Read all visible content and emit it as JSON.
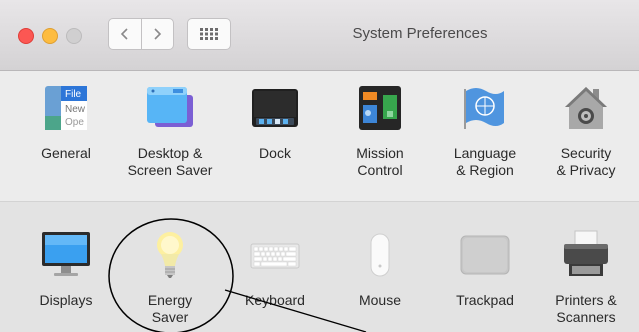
{
  "window": {
    "title": "System Preferences",
    "back_icon": "chevron-left-icon",
    "forward_icon": "chevron-right-icon",
    "grid_icon": "show-all-grid-icon"
  },
  "row1": [
    {
      "id": "general",
      "line1": "General",
      "line2": "",
      "icon": "general-icon"
    },
    {
      "id": "desktop",
      "line1": "Desktop &",
      "line2": "Screen Saver",
      "icon": "desktop-screensaver-icon"
    },
    {
      "id": "dock",
      "line1": "Dock",
      "line2": "",
      "icon": "dock-icon"
    },
    {
      "id": "mission",
      "line1": "Mission",
      "line2": "Control",
      "icon": "mission-control-icon"
    },
    {
      "id": "language",
      "line1": "Language",
      "line2": "& Region",
      "icon": "language-region-icon"
    },
    {
      "id": "security",
      "line1": "Security",
      "line2": "& Privacy",
      "icon": "security-privacy-icon"
    }
  ],
  "row2": [
    {
      "id": "displays",
      "line1": "Displays",
      "line2": "",
      "icon": "displays-icon"
    },
    {
      "id": "energy",
      "line1": "Energy",
      "line2": "Saver",
      "icon": "energy-saver-icon"
    },
    {
      "id": "keyboard",
      "line1": "Keyboard",
      "line2": "",
      "icon": "keyboard-icon"
    },
    {
      "id": "mouse",
      "line1": "Mouse",
      "line2": "",
      "icon": "mouse-icon"
    },
    {
      "id": "trackpad",
      "line1": "Trackpad",
      "line2": "",
      "icon": "trackpad-icon"
    },
    {
      "id": "printers",
      "line1": "Printers &",
      "line2": "Scanners",
      "icon": "printers-scanners-icon"
    }
  ],
  "general_icon_text": [
    "File",
    "New",
    "Ope"
  ],
  "colors": {
    "accent": "#3f9cf5",
    "close": "#fc5753",
    "minimize": "#fdbc40",
    "zoom": "#d0cfd0",
    "annotation": "#000000"
  }
}
